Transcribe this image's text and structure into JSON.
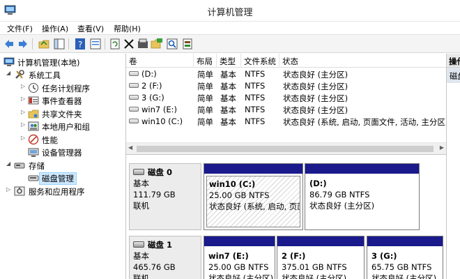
{
  "window": {
    "title": "计算机管理"
  },
  "menu": [
    "文件(F)",
    "操作(A)",
    "查看(V)",
    "帮助(H)"
  ],
  "toolbar": {
    "icons": [
      "back-arrow-icon",
      "forward-arrow-icon",
      "up-folder-icon",
      "show-tree-icon",
      "help-icon",
      "properties-icon",
      "refresh-icon",
      "delete-icon",
      "format-icon",
      "open-icon",
      "search-icon",
      "disk-properties-icon"
    ]
  },
  "tree": {
    "root": "计算机管理(本地)",
    "system_tools": "系统工具",
    "items": [
      "任务计划程序",
      "事件查看器",
      "共享文件夹",
      "本地用户和组",
      "性能",
      "设备管理器"
    ],
    "storage": "存储",
    "disk_mgmt": "磁盘管理",
    "services": "服务和应用程序"
  },
  "volumes": {
    "headers": [
      "卷",
      "布局",
      "类型",
      "文件系统",
      "状态"
    ],
    "rows": [
      {
        "name": "(D:)",
        "layout": "简单",
        "type": "基本",
        "fs": "NTFS",
        "status": "状态良好 (主分区)"
      },
      {
        "name": "2 (F:)",
        "layout": "简单",
        "type": "基本",
        "fs": "NTFS",
        "status": "状态良好 (主分区)"
      },
      {
        "name": "3 (G:)",
        "layout": "简单",
        "type": "基本",
        "fs": "NTFS",
        "status": "状态良好 (主分区)"
      },
      {
        "name": "win7 (E:)",
        "layout": "简单",
        "type": "基本",
        "fs": "NTFS",
        "status": "状态良好 (主分区)"
      },
      {
        "name": "win10 (C:)",
        "layout": "简单",
        "type": "基本",
        "fs": "NTFS",
        "status": "状态良好 (系统, 启动, 页面文件, 活动, 主分区)"
      }
    ]
  },
  "disks": [
    {
      "name": "磁盘 0",
      "type": "基本",
      "size": "111.79 GB",
      "state": "联机",
      "partitions": [
        {
          "name": "win10  (C:)",
          "size": "25.00 GB NTFS",
          "status": "状态良好 (系统, 启动, 页面"
        },
        {
          "name": "(D:)",
          "size": "86.79 GB NTFS",
          "status": "状态良好 (主分区)"
        }
      ]
    },
    {
      "name": "磁盘 1",
      "type": "基本",
      "size": "465.76 GB",
      "state": "联机",
      "partitions": [
        {
          "name": "win7  (E:)",
          "size": "25.00 GB NTFS",
          "status": "状态良好 (主分区)"
        },
        {
          "name": "2  (F:)",
          "size": "375.01 GB NTFS",
          "status": "状态良好 (主分区)"
        },
        {
          "name": "3  (G:)",
          "size": "65.75 GB NTFS",
          "status": "状态良好 (主分区)"
        }
      ]
    }
  ],
  "actions": {
    "header": "操作",
    "item": "磁盘管理"
  },
  "colors": {
    "partition_bar": "#1a1a8c",
    "selection": "#cce8ff"
  }
}
